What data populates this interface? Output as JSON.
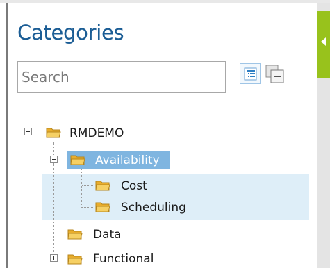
{
  "panel": {
    "title": "Categories",
    "search": {
      "placeholder": "Search",
      "value": ""
    }
  },
  "tree": {
    "root": {
      "label": "RMDEMO",
      "state": "expanded"
    },
    "items": [
      {
        "label": "Availability",
        "state": "expanded",
        "selected": true
      },
      {
        "label": "Cost",
        "state": "leaf"
      },
      {
        "label": "Scheduling",
        "state": "leaf"
      },
      {
        "label": "Data",
        "state": "leaf"
      },
      {
        "label": "Functional",
        "state": "collapsed"
      }
    ]
  },
  "icons": {
    "expand_all": "expand-all-icon",
    "collapse_all": "collapse-all-icon",
    "folder": "folder-icon",
    "toggle": "chevron-left-icon"
  },
  "colors": {
    "title": "#1b5d95",
    "selection": "#7fb5e0",
    "selection_band": "#deeef8",
    "toggle_tab": "#98c21c",
    "folder": "#f3c649"
  }
}
